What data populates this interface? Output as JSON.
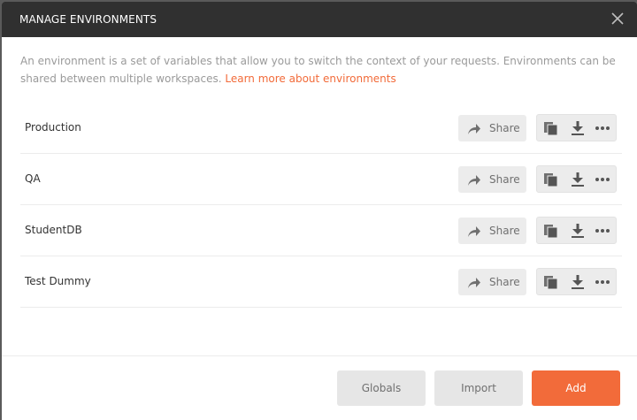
{
  "modal": {
    "title": "MANAGE ENVIRONMENTS",
    "close_icon": "close-icon",
    "description": "An environment is a set of variables that allow you to switch the context of your requests. Environments can be shared between multiple workspaces.",
    "learn_more_link": "Learn more about environments",
    "link_color": "#f26b3a"
  },
  "environments": [
    {
      "name": "Production",
      "share_label": "Share"
    },
    {
      "name": "QA",
      "share_label": "Share"
    },
    {
      "name": "StudentDB",
      "share_label": "Share"
    },
    {
      "name": "Test Dummy",
      "share_label": "Share"
    }
  ],
  "row_icons": {
    "share": "share-arrow-icon",
    "duplicate": "copy-icon",
    "download": "download-icon",
    "more": "more-options-icon"
  },
  "footer": {
    "globals_label": "Globals",
    "import_label": "Import",
    "add_label": "Add",
    "accent_color": "#f26b3a"
  }
}
